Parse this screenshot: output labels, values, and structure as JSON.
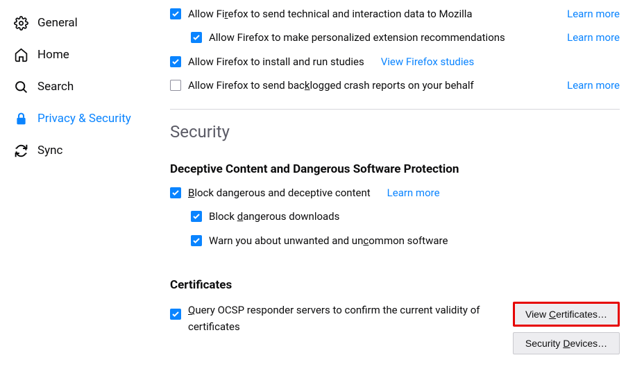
{
  "sidebar": {
    "items": [
      {
        "label": "General",
        "icon": "gear"
      },
      {
        "label": "Home",
        "icon": "home"
      },
      {
        "label": "Search",
        "icon": "search"
      },
      {
        "label": "Privacy & Security",
        "icon": "lock"
      },
      {
        "label": "Sync",
        "icon": "sync"
      }
    ]
  },
  "dataCollection": {
    "allowTechnical": {
      "label_pre": "Allow Fi",
      "label_u": "r",
      "label_post": "efox to send technical and interaction data to Mozilla",
      "checked": true,
      "learnMore": "Learn more"
    },
    "allowExtRec": {
      "label": "Allow Firefox to make personalized extension recommendations",
      "checked": true,
      "learnMore": "Learn more"
    },
    "allowStudies": {
      "label": "Allow Firefox to install and run studies",
      "checked": true,
      "viewStudies": "View Firefox studies"
    },
    "allowCrash": {
      "label_pre": "Allow Firefox to send bac",
      "label_u": "k",
      "label_post": "logged crash reports on your behalf",
      "checked": false,
      "learnMore": "Learn more"
    }
  },
  "security": {
    "title": "Security",
    "deceptive": {
      "title": "Deceptive Content and Dangerous Software Protection",
      "block": {
        "label_pre": "",
        "label_u": "B",
        "label_post": "lock dangerous and deceptive content",
        "checked": true,
        "learnMore": "Learn more"
      },
      "blockDownloads": {
        "label_pre": "Block ",
        "label_u": "d",
        "label_post": "angerous downloads",
        "checked": true
      },
      "warnUncommon": {
        "label_pre": "Warn you about unwanted and un",
        "label_u": "c",
        "label_post": "ommon software",
        "checked": true
      }
    },
    "certificates": {
      "title": "Certificates",
      "ocsp": {
        "label_pre": "",
        "label_u": "Q",
        "label_post": "uery OCSP responder servers to confirm the current validity of certificates",
        "checked": true
      },
      "viewBtn": {
        "pre": "View ",
        "u": "C",
        "post": "ertificates…"
      },
      "devicesBtn": {
        "pre": "Security ",
        "u": "D",
        "post": "evices…"
      }
    }
  }
}
